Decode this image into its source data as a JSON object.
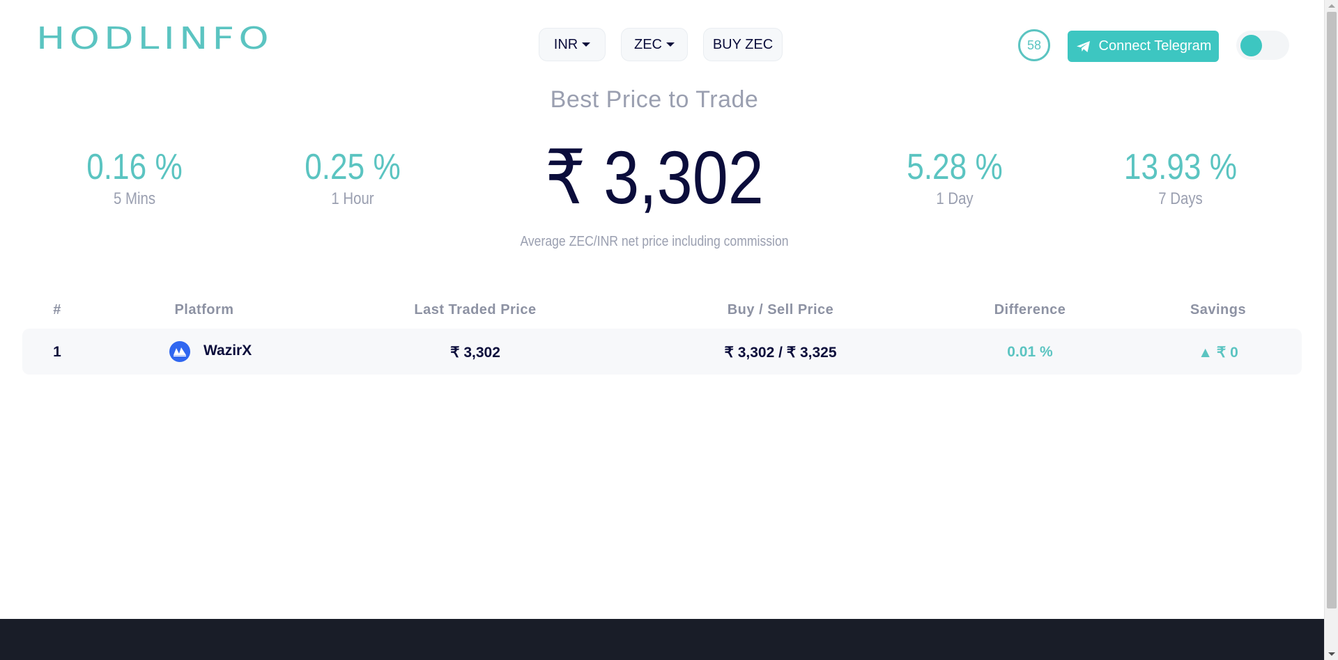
{
  "header": {
    "logo": "HODLINFO",
    "currency_select": "INR",
    "coin_select": "ZEC",
    "buy_button": "BUY ZEC",
    "timer": "58",
    "telegram_button": "Connect Telegram"
  },
  "hero": {
    "title": "Best Price to Trade",
    "price": "₹ 3,302",
    "subtitle": "Average ZEC/INR net price including commission",
    "stats": [
      {
        "value": "0.16 %",
        "label": "5 Mins"
      },
      {
        "value": "0.25 %",
        "label": "1 Hour"
      },
      {
        "value": "5.28 %",
        "label": "1 Day"
      },
      {
        "value": "13.93 %",
        "label": "7 Days"
      }
    ]
  },
  "table": {
    "headers": [
      "#",
      "Platform",
      "Last Traded Price",
      "Buy / Sell Price",
      "Difference",
      "Savings"
    ],
    "rows": [
      {
        "rank": "1",
        "platform": "WazirX",
        "last_traded": "₹ 3,302",
        "buy_sell": "₹ 3,302 / ₹ 3,325",
        "difference": "0.01 %",
        "savings": "▲ ₹ 0"
      }
    ]
  },
  "colors": {
    "accent": "#5bc4c1",
    "dark_text": "#0b0d3b",
    "muted": "#9a9fb0",
    "footer": "#191d28"
  }
}
